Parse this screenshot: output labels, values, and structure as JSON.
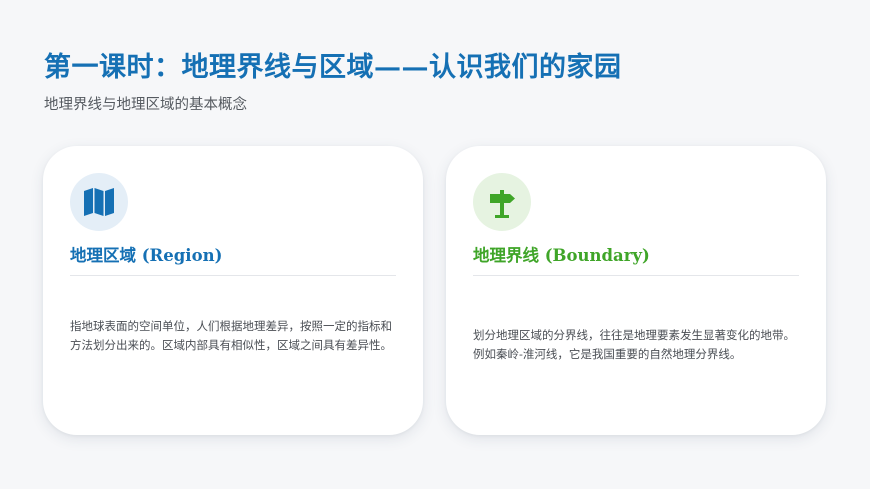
{
  "page": {
    "title": "第一课时：地理界线与区域——认识我们的家园",
    "subtitle": "地理界线与地理区域的基本概念"
  },
  "cards": [
    {
      "icon": "map-icon",
      "heading": "地理区域 (Region)",
      "body": "指地球表面的空间单位，人们根据地理差异，按照一定的指标和方法划分出来的。区域内部具有相似性，区域之间具有差异性。",
      "accent_color": "#1570b4"
    },
    {
      "icon": "signpost-icon",
      "heading": "地理界线 (Boundary)",
      "body": "划分地理区域的分界线，往往是地理要素发生显著变化的地带。例如秦岭-淮河线，它是我国重要的自然地理分界线。",
      "accent_color": "#3fa528"
    }
  ]
}
